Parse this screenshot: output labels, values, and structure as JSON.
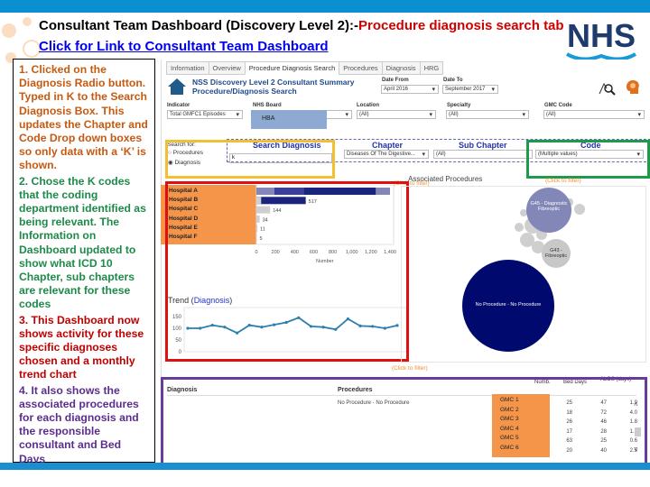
{
  "slide": {
    "title_black": "Consultant Team Dashboard (Discovery Level 2):-",
    "title_red": "Procedure diagnosis search tab",
    "link": "Click for Link to Consultant Team Dashboard",
    "logo": "NHS"
  },
  "notes": [
    {
      "text": "1. Clicked on the Diagnosis Radio button. Typed in K to the Search Diagnosis Box.  This updates the Chapter and Code Drop down boxes so only data with a ‘K’ is shown.",
      "color": "#c55a11"
    },
    {
      "text": "2.  Chose the K codes that the coding department identified as being relevant.  The Information on Dashboard updated to show what ICD 10 Chapter, sub chapters are relevant for these codes",
      "color": "#1e8a4a"
    },
    {
      "text": "3.  This Dashboard now shows activity for these specific diagnoses chosen and a monthly trend chart",
      "color": "#c00000"
    },
    {
      "text": "4.   It also shows the associated procedures for each diagnosis and the responsible consultant and Bed Days",
      "color": "#5b2d8e"
    }
  ],
  "dashboard": {
    "tabs": [
      "Information",
      "Overview",
      "Procedure Diagnosis Search",
      "Procedures",
      "Diagnosis",
      "HRG"
    ],
    "active_tab": "Procedure Diagnosis Search",
    "header_line1": "NSS Discovery Level 2 Consultant Summary",
    "header_line2": "Procedure/Diagnosis Search",
    "date_from": {
      "label": "Date From",
      "value": "April 2016"
    },
    "date_to": {
      "label": "Date To",
      "value": "September 2017"
    },
    "indicator": {
      "label": "Indicator",
      "value": "Total GMFC1 Episodes"
    },
    "nhs_board": {
      "label": "NHS Board",
      "value": "HBA"
    },
    "location": {
      "label": "Location",
      "value": "(All)"
    },
    "specialty": {
      "label": "Specialty",
      "value": "(All)"
    },
    "gmc_code": {
      "label": "GMC Code",
      "value": "(All)"
    },
    "search_for": {
      "label": "Search for:",
      "options": [
        "Procedures",
        "Diagnosis"
      ],
      "selected": "Diagnosis"
    },
    "search_diagnosis": {
      "label": "Search Diagnosis",
      "value": "k"
    },
    "chapter": {
      "label": "Chapter",
      "value": "Diseases Of The Digestive..."
    },
    "sub_chapter": {
      "label": "Sub Chapter",
      "value": "(All)"
    },
    "code": {
      "label": "Code",
      "value": "(Multiple values)"
    },
    "click_to_filter": "(Click to filter)",
    "associated_procedures_title": "Associated Procedures",
    "bubbles": [
      {
        "label": "No Procedure - No Procedure",
        "color": "#000a6e"
      },
      {
        "label": "G45 - Diagnostic Fibreoptic",
        "color": "#8287b8"
      },
      {
        "label": "G43 - Fibreoptic",
        "color": "#c8c8c8"
      }
    ],
    "colors": {
      "highlight_orange": "#f4954a",
      "yellow": "#f0c030",
      "red": "#e01010",
      "green": "#1e9a4a",
      "purple": "#6a3a9a",
      "navy": "#1a237e"
    }
  },
  "chart_data": [
    {
      "type": "bar",
      "orientation": "horizontal",
      "categories": [
        "Hospital A",
        "Hospital B",
        "Hospital C",
        "Hospital D",
        "Hospital E",
        "Hospital F"
      ],
      "values": [
        1400,
        517,
        144,
        34,
        11,
        5
      ],
      "data_labels": [
        "",
        "517",
        "144",
        "34",
        "11",
        "5"
      ],
      "xlabel": "Number",
      "xticks": [
        "0",
        "200",
        "400",
        "600",
        "800",
        "1,000",
        "1,200",
        "1,400"
      ],
      "xlim": [
        0,
        1400
      ]
    },
    {
      "type": "line",
      "title_prefix": "Trend (",
      "title_highlight": "Diagnosis",
      "title_suffix": ")",
      "values": [
        100,
        100,
        113,
        105,
        80,
        113,
        105,
        115,
        125,
        145,
        108,
        105,
        95,
        140,
        110,
        108,
        100,
        112
      ],
      "yticks": [
        "150",
        "100",
        "50",
        "0"
      ],
      "ylim": [
        0,
        150
      ]
    }
  ],
  "table": {
    "headers": [
      "Diagnosis",
      "Procedures",
      "Numb.",
      "Bed Days",
      "ALOS (days)"
    ],
    "procedure": "No Procedure - No Procedure",
    "rows": [
      {
        "gmc": "GMC 1",
        "num": "25",
        "bed": "47",
        "alos": "1.9"
      },
      {
        "gmc": "GMC 2",
        "num": "18",
        "bed": "72",
        "alos": "4.0"
      },
      {
        "gmc": "GMC 3",
        "num": "26",
        "bed": "46",
        "alos": "1.8"
      },
      {
        "gmc": "GMC 4",
        "num": "17",
        "bed": "28",
        "alos": "1.6"
      },
      {
        "gmc": "GMC 5",
        "num": "63",
        "bed": "25",
        "alos": "0.6"
      },
      {
        "gmc": "GMC 6",
        "num": "20",
        "bed": "40",
        "alos": "2.5"
      }
    ]
  }
}
